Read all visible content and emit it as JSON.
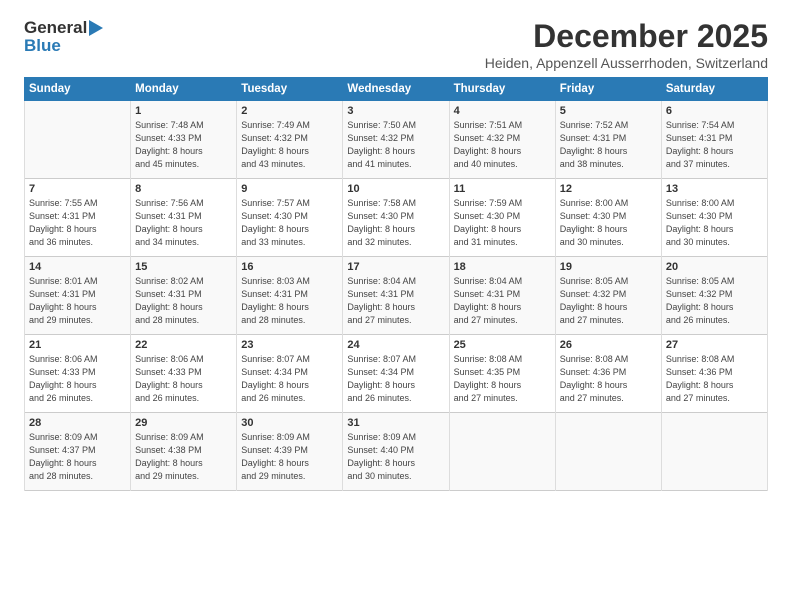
{
  "logo": {
    "general": "General",
    "blue": "Blue"
  },
  "title": "December 2025",
  "location": "Heiden, Appenzell Ausserrhoden, Switzerland",
  "days_header": [
    "Sunday",
    "Monday",
    "Tuesday",
    "Wednesday",
    "Thursday",
    "Friday",
    "Saturday"
  ],
  "weeks": [
    [
      {
        "day": "",
        "content": ""
      },
      {
        "day": "1",
        "content": "Sunrise: 7:48 AM\nSunset: 4:33 PM\nDaylight: 8 hours\nand 45 minutes."
      },
      {
        "day": "2",
        "content": "Sunrise: 7:49 AM\nSunset: 4:32 PM\nDaylight: 8 hours\nand 43 minutes."
      },
      {
        "day": "3",
        "content": "Sunrise: 7:50 AM\nSunset: 4:32 PM\nDaylight: 8 hours\nand 41 minutes."
      },
      {
        "day": "4",
        "content": "Sunrise: 7:51 AM\nSunset: 4:32 PM\nDaylight: 8 hours\nand 40 minutes."
      },
      {
        "day": "5",
        "content": "Sunrise: 7:52 AM\nSunset: 4:31 PM\nDaylight: 8 hours\nand 38 minutes."
      },
      {
        "day": "6",
        "content": "Sunrise: 7:54 AM\nSunset: 4:31 PM\nDaylight: 8 hours\nand 37 minutes."
      }
    ],
    [
      {
        "day": "7",
        "content": "Sunrise: 7:55 AM\nSunset: 4:31 PM\nDaylight: 8 hours\nand 36 minutes."
      },
      {
        "day": "8",
        "content": "Sunrise: 7:56 AM\nSunset: 4:31 PM\nDaylight: 8 hours\nand 34 minutes."
      },
      {
        "day": "9",
        "content": "Sunrise: 7:57 AM\nSunset: 4:30 PM\nDaylight: 8 hours\nand 33 minutes."
      },
      {
        "day": "10",
        "content": "Sunrise: 7:58 AM\nSunset: 4:30 PM\nDaylight: 8 hours\nand 32 minutes."
      },
      {
        "day": "11",
        "content": "Sunrise: 7:59 AM\nSunset: 4:30 PM\nDaylight: 8 hours\nand 31 minutes."
      },
      {
        "day": "12",
        "content": "Sunrise: 8:00 AM\nSunset: 4:30 PM\nDaylight: 8 hours\nand 30 minutes."
      },
      {
        "day": "13",
        "content": "Sunrise: 8:00 AM\nSunset: 4:30 PM\nDaylight: 8 hours\nand 30 minutes."
      }
    ],
    [
      {
        "day": "14",
        "content": "Sunrise: 8:01 AM\nSunset: 4:31 PM\nDaylight: 8 hours\nand 29 minutes."
      },
      {
        "day": "15",
        "content": "Sunrise: 8:02 AM\nSunset: 4:31 PM\nDaylight: 8 hours\nand 28 minutes."
      },
      {
        "day": "16",
        "content": "Sunrise: 8:03 AM\nSunset: 4:31 PM\nDaylight: 8 hours\nand 28 minutes."
      },
      {
        "day": "17",
        "content": "Sunrise: 8:04 AM\nSunset: 4:31 PM\nDaylight: 8 hours\nand 27 minutes."
      },
      {
        "day": "18",
        "content": "Sunrise: 8:04 AM\nSunset: 4:31 PM\nDaylight: 8 hours\nand 27 minutes."
      },
      {
        "day": "19",
        "content": "Sunrise: 8:05 AM\nSunset: 4:32 PM\nDaylight: 8 hours\nand 27 minutes."
      },
      {
        "day": "20",
        "content": "Sunrise: 8:05 AM\nSunset: 4:32 PM\nDaylight: 8 hours\nand 26 minutes."
      }
    ],
    [
      {
        "day": "21",
        "content": "Sunrise: 8:06 AM\nSunset: 4:33 PM\nDaylight: 8 hours\nand 26 minutes."
      },
      {
        "day": "22",
        "content": "Sunrise: 8:06 AM\nSunset: 4:33 PM\nDaylight: 8 hours\nand 26 minutes."
      },
      {
        "day": "23",
        "content": "Sunrise: 8:07 AM\nSunset: 4:34 PM\nDaylight: 8 hours\nand 26 minutes."
      },
      {
        "day": "24",
        "content": "Sunrise: 8:07 AM\nSunset: 4:34 PM\nDaylight: 8 hours\nand 26 minutes."
      },
      {
        "day": "25",
        "content": "Sunrise: 8:08 AM\nSunset: 4:35 PM\nDaylight: 8 hours\nand 27 minutes."
      },
      {
        "day": "26",
        "content": "Sunrise: 8:08 AM\nSunset: 4:36 PM\nDaylight: 8 hours\nand 27 minutes."
      },
      {
        "day": "27",
        "content": "Sunrise: 8:08 AM\nSunset: 4:36 PM\nDaylight: 8 hours\nand 27 minutes."
      }
    ],
    [
      {
        "day": "28",
        "content": "Sunrise: 8:09 AM\nSunset: 4:37 PM\nDaylight: 8 hours\nand 28 minutes."
      },
      {
        "day": "29",
        "content": "Sunrise: 8:09 AM\nSunset: 4:38 PM\nDaylight: 8 hours\nand 29 minutes."
      },
      {
        "day": "30",
        "content": "Sunrise: 8:09 AM\nSunset: 4:39 PM\nDaylight: 8 hours\nand 29 minutes."
      },
      {
        "day": "31",
        "content": "Sunrise: 8:09 AM\nSunset: 4:40 PM\nDaylight: 8 hours\nand 30 minutes."
      },
      {
        "day": "",
        "content": ""
      },
      {
        "day": "",
        "content": ""
      },
      {
        "day": "",
        "content": ""
      }
    ]
  ]
}
